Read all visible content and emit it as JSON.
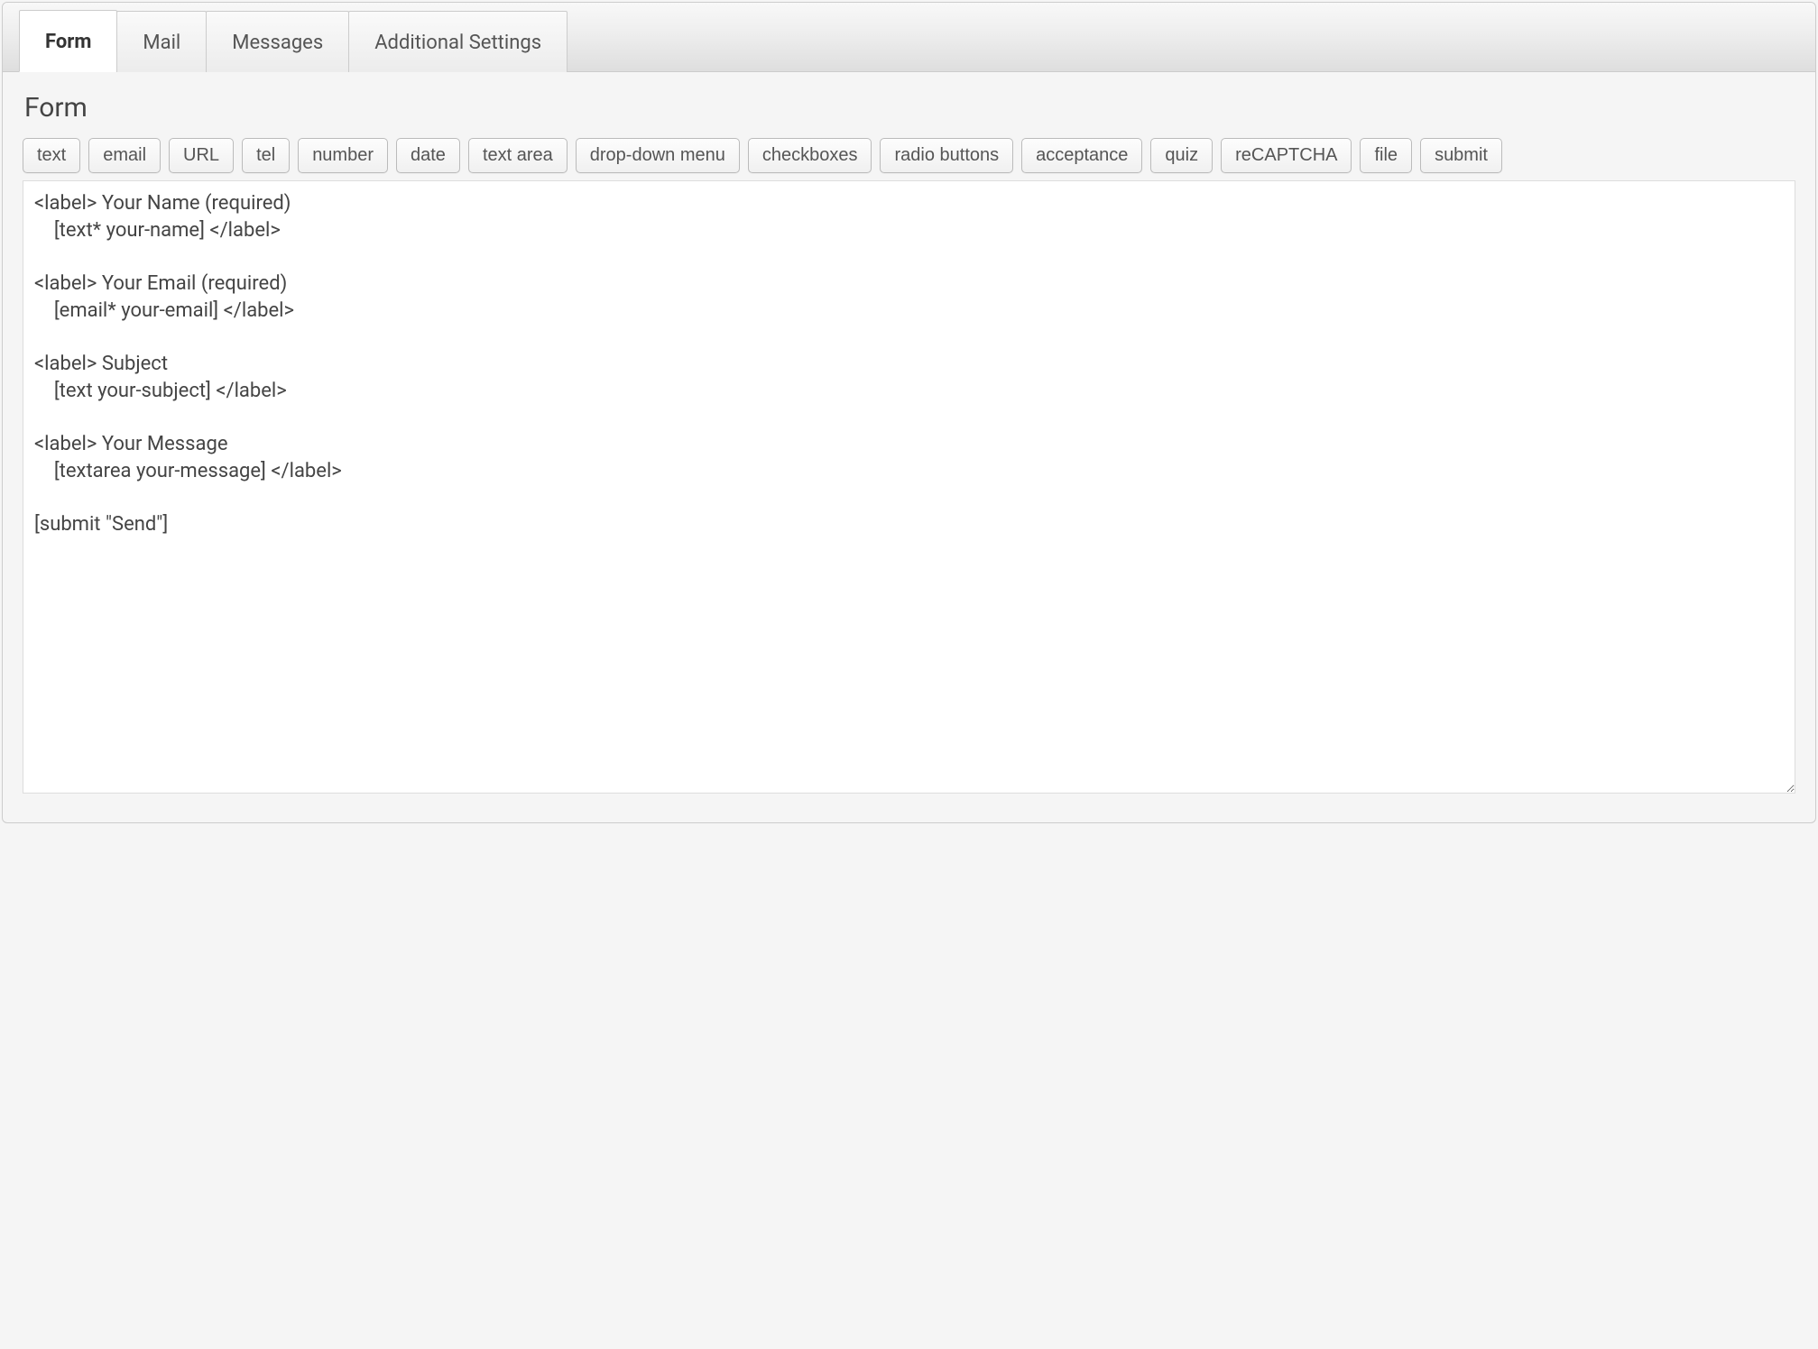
{
  "tabs": [
    {
      "label": "Form",
      "active": true
    },
    {
      "label": "Mail",
      "active": false
    },
    {
      "label": "Messages",
      "active": false
    },
    {
      "label": "Additional Settings",
      "active": false
    }
  ],
  "section_title": "Form",
  "tag_buttons": [
    "text",
    "email",
    "URL",
    "tel",
    "number",
    "date",
    "text area",
    "drop-down menu",
    "checkboxes",
    "radio buttons",
    "acceptance",
    "quiz",
    "reCAPTCHA",
    "file",
    "submit"
  ],
  "editor_value": "<label> Your Name (required)\n    [text* your-name] </label>\n\n<label> Your Email (required)\n    [email* your-email] </label>\n\n<label> Subject\n    [text your-subject] </label>\n\n<label> Your Message\n    [textarea your-message] </label>\n\n[submit \"Send\"]"
}
